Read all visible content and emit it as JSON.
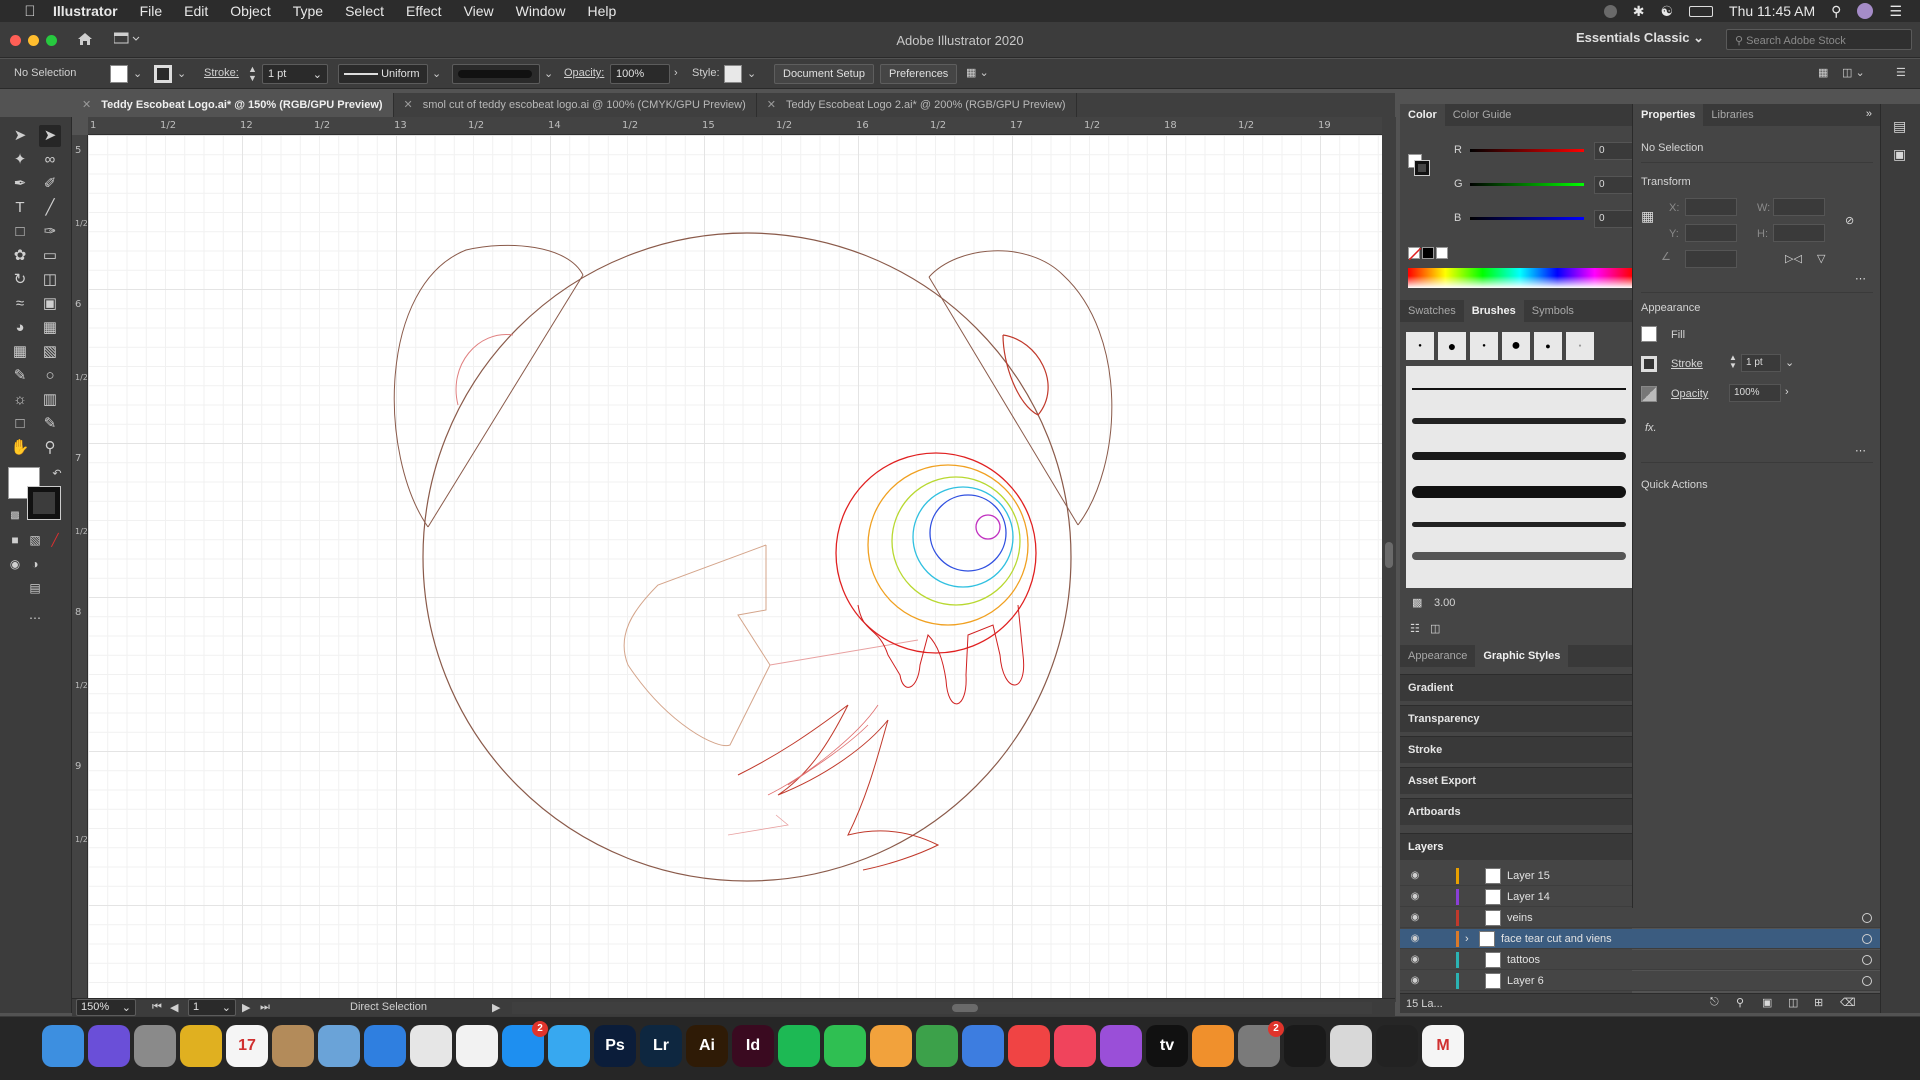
{
  "menubar": {
    "app_name": "Illustrator",
    "items": [
      "File",
      "Edit",
      "Object",
      "Type",
      "Select",
      "Effect",
      "View",
      "Window",
      "Help"
    ],
    "clock": "Thu 11:45 AM"
  },
  "window": {
    "title": "Adobe Illustrator 2020",
    "workspace": "Essentials Classic",
    "stock_search_placeholder": "Search Adobe Stock"
  },
  "controlbar": {
    "selection": "No Selection",
    "stroke_label": "Stroke:",
    "stroke_value": "1 pt",
    "profile": "Uniform",
    "opacity_label": "Opacity:",
    "opacity_value": "100%",
    "style_label": "Style:",
    "document_setup": "Document Setup",
    "preferences": "Preferences"
  },
  "tabs": [
    {
      "label": "Teddy Escobeat Logo.ai* @ 150% (RGB/GPU Preview)",
      "active": true
    },
    {
      "label": "smol cut of teddy escobeat logo.ai @ 100% (CMYK/GPU Preview)",
      "active": false
    },
    {
      "label": "Teddy Escobeat Logo 2.ai* @ 200% (RGB/GPU Preview)",
      "active": false
    }
  ],
  "ruler": {
    "h_labels": [
      "1",
      "1/2",
      "12",
      "1/2",
      "13",
      "1/2",
      "14",
      "1/2",
      "15",
      "1/2",
      "16",
      "1/2",
      "17",
      "1/2",
      "18",
      "1/2",
      "19"
    ],
    "v_labels": [
      "5",
      "1/2",
      "6",
      "1/2",
      "7",
      "1/2",
      "8",
      "1/2",
      "9",
      "1/2"
    ]
  },
  "statusbar": {
    "zoom": "150%",
    "artboard": "1",
    "tool": "Direct Selection"
  },
  "color_panel": {
    "tabs": [
      "Color",
      "Color Guide"
    ],
    "r_label": "R",
    "r_value": "0",
    "g_label": "G",
    "g_value": "0",
    "b_label": "B",
    "b_value": "0"
  },
  "brushes_panel": {
    "tabs": [
      "Swatches",
      "Brushes",
      "Symbols"
    ],
    "size_value": "3.00"
  },
  "appearance_tabs": [
    "Appearance",
    "Graphic Styles"
  ],
  "collapsed_panels": [
    "Gradient",
    "Transparency",
    "Stroke",
    "Asset Export",
    "Artboards"
  ],
  "properties": {
    "tabs": [
      "Properties",
      "Libraries"
    ],
    "selection": "No Selection",
    "transform_title": "Transform",
    "x_label": "X:",
    "y_label": "Y:",
    "w_label": "W:",
    "h_label": "H:",
    "appearance_title": "Appearance",
    "fill_label": "Fill",
    "stroke_label": "Stroke",
    "stroke_value": "1 pt",
    "opacity_label": "Opacity",
    "opacity_value": "100%",
    "fx_label": "fx.",
    "quick_actions": "Quick Actions"
  },
  "layers": {
    "title": "Layers",
    "rows": [
      {
        "name": "Layer 15",
        "color": "#e8a000",
        "selected": false
      },
      {
        "name": "Layer 14",
        "color": "#8a3fd6",
        "selected": false
      },
      {
        "name": "veins",
        "color": "#c0392b",
        "selected": false
      },
      {
        "name": "face tear cut and viens",
        "color": "#d97a2b",
        "selected": true
      },
      {
        "name": "tattoos",
        "color": "#2bb3b3",
        "selected": false
      },
      {
        "name": "Layer 6",
        "color": "#2bb3b3",
        "selected": false
      }
    ],
    "count": "15 La..."
  },
  "dock": {
    "apps": [
      {
        "name": "Finder",
        "label": "",
        "color": "#3d8fe0"
      },
      {
        "name": "Siri",
        "label": "",
        "color": "#6a4fd8"
      },
      {
        "name": "Launchpad",
        "label": "",
        "color": "#8a8a8a"
      },
      {
        "name": "Chrome",
        "label": "",
        "color": "#e0b020"
      },
      {
        "name": "Calendar",
        "label": "17",
        "color": "#f5f5f5"
      },
      {
        "name": "Contacts",
        "label": "",
        "color": "#b38b5a"
      },
      {
        "name": "Preview",
        "label": "",
        "color": "#6aa3d8"
      },
      {
        "name": "Safari",
        "label": "",
        "color": "#2f7fe0"
      },
      {
        "name": "Photos",
        "label": "",
        "color": "#e6e6e6"
      },
      {
        "name": "Notes",
        "label": "",
        "color": "#f2f2f2"
      },
      {
        "name": "App Store",
        "label": "",
        "color": "#1e8ff0",
        "badge": "2"
      },
      {
        "name": "Messages",
        "label": "",
        "color": "#37a8f0"
      },
      {
        "name": "Photoshop",
        "label": "Ps",
        "color": "#0b1d3a"
      },
      {
        "name": "Lightroom",
        "label": "Lr",
        "color": "#0e2740"
      },
      {
        "name": "Illustrator",
        "label": "Ai",
        "color": "#2f1b06"
      },
      {
        "name": "InDesign",
        "label": "Id",
        "color": "#3a0a20"
      },
      {
        "name": "Spotify",
        "label": "",
        "color": "#1db954"
      },
      {
        "name": "FaceTime",
        "label": "",
        "color": "#2fbf52"
      },
      {
        "name": "Pages",
        "label": "",
        "color": "#f2a23c"
      },
      {
        "name": "Numbers",
        "label": "",
        "color": "#3ca14a"
      },
      {
        "name": "Keynote",
        "label": "",
        "color": "#3d7de0"
      },
      {
        "name": "News",
        "label": "",
        "color": "#f04444"
      },
      {
        "name": "Music",
        "label": "",
        "color": "#f0445c"
      },
      {
        "name": "Podcasts",
        "label": "",
        "color": "#9a4fd8"
      },
      {
        "name": "TV",
        "label": "tv",
        "color": "#111111"
      },
      {
        "name": "Books",
        "label": "",
        "color": "#f0902c"
      },
      {
        "name": "System Preferences",
        "label": "",
        "color": "#7a7a7a",
        "badge": "2"
      },
      {
        "name": "Activity Monitor",
        "label": "",
        "color": "#1a1a1a"
      },
      {
        "name": "Script Editor",
        "label": "",
        "color": "#d8d8d8"
      },
      {
        "name": "Acrobat",
        "label": "",
        "color": "#222222"
      },
      {
        "name": "Gmail",
        "label": "M",
        "color": "#f5f5f5"
      }
    ]
  }
}
